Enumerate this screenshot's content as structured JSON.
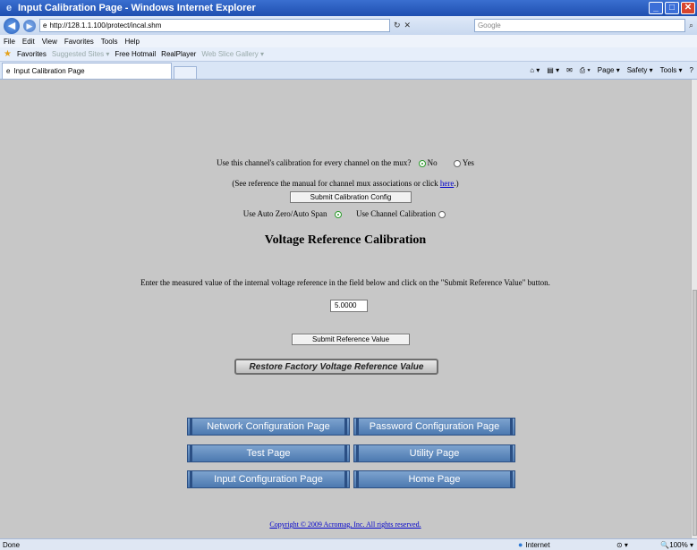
{
  "window": {
    "title": "Input Calibration Page - Windows Internet Explorer"
  },
  "address": {
    "url": "http://128.1.1.100/protect/incal.shm",
    "search_placeholder": "Google"
  },
  "menu": [
    "File",
    "Edit",
    "View",
    "Favorites",
    "Tools",
    "Help"
  ],
  "favorites": {
    "label": "Favorites",
    "items": [
      "Suggested Sites ▾",
      "Free Hotmail",
      "RealPlayer",
      "Web Slice Gallery ▾"
    ]
  },
  "tab": {
    "label": "Input Calibration Page"
  },
  "commandbar": [
    "Page ▾",
    "Safety ▾",
    "Tools ▾"
  ],
  "page": {
    "mux_question": "Use this channel's calibration for every channel on the mux?",
    "mux_no": "No",
    "mux_yes": "Yes",
    "mux_note_prefix": "(See reference the manual for channel mux associations or click ",
    "mux_note_link": "here",
    "mux_note_suffix": ".)",
    "auto_zero_label": "Use Auto Zero/Auto Span",
    "channel_cal_label": "Use Channel Calibration",
    "submit_cal_config": "Submit Calibration Config",
    "voltage_heading": "Voltage Reference Calibration",
    "voltage_instructions": "Enter the measured value of the internal voltage reference in the field below and click on the \"Submit Reference Value\" button.",
    "voltage_value": "5.0000",
    "submit_reference": "Submit Reference Value",
    "restore_factory": "Restore Factory Voltage Reference Value",
    "nav": {
      "network": "Network Configuration Page",
      "password": "Password Configuration Page",
      "test": "Test Page",
      "utility": "Utility Page",
      "input": "Input Configuration Page",
      "home": "Home Page"
    },
    "copyright": "Copyright © 2009 Acromag, Inc. All rights reserved."
  },
  "status": {
    "text": "Done",
    "zone": "Internet",
    "zoom": "100%"
  }
}
